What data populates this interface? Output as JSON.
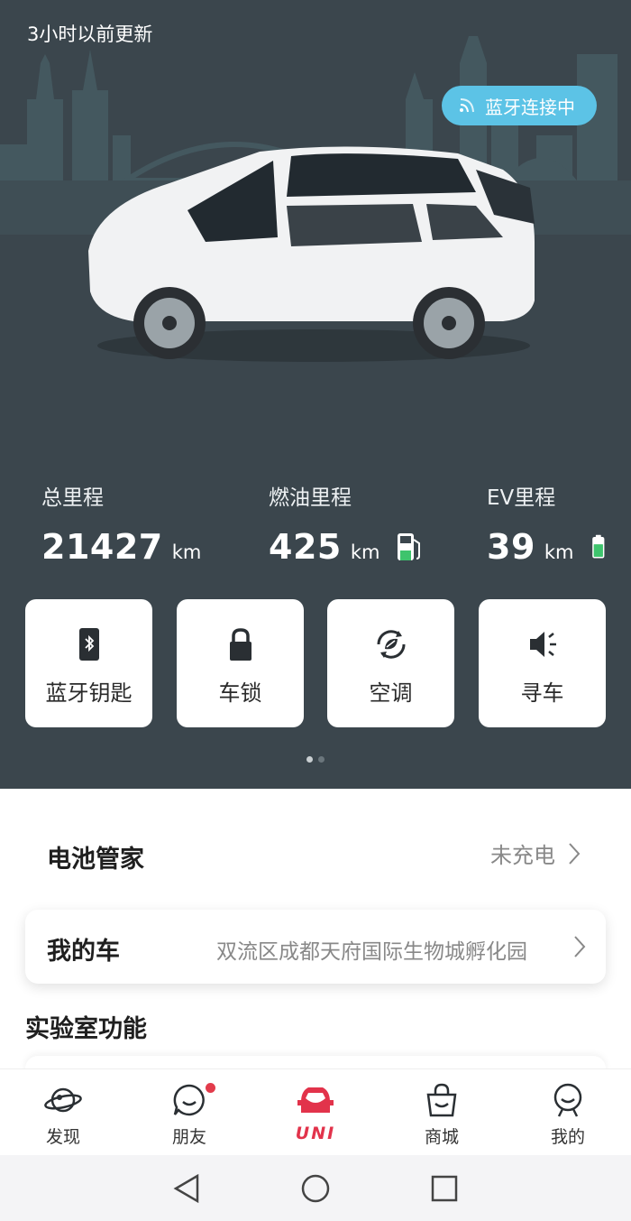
{
  "header": {
    "updated": "3小时以前更新",
    "bluetooth_status": "蓝牙连接中"
  },
  "stats": [
    {
      "label": "总里程",
      "value": "21427",
      "unit": "km"
    },
    {
      "label": "燃油里程",
      "value": "425",
      "unit": "km",
      "icon": "fuel-pump-icon"
    },
    {
      "label": "EV里程",
      "value": "39",
      "unit": "km",
      "icon": "battery-icon"
    }
  ],
  "quick_actions": [
    {
      "label": "蓝牙钥匙",
      "icon": "bluetooth-key-icon"
    },
    {
      "label": "车锁",
      "icon": "lock-icon"
    },
    {
      "label": "空调",
      "icon": "air-conditioner-icon"
    },
    {
      "label": "寻车",
      "icon": "speaker-icon"
    }
  ],
  "battery": {
    "title": "电池管家",
    "status": "未充电"
  },
  "my_car": {
    "title": "我的车",
    "address": "双流区成都天府国际生物城孵化园"
  },
  "lab": {
    "title": "实验室功能"
  },
  "tabs": [
    {
      "label": "发现",
      "icon": "planet-icon"
    },
    {
      "label": "朋友",
      "icon": "chat-icon"
    },
    {
      "label": "UNI",
      "icon": "uni-car-icon"
    },
    {
      "label": "商城",
      "icon": "shopping-bag-icon"
    },
    {
      "label": "我的",
      "icon": "profile-icon"
    }
  ],
  "colors": {
    "hero_bg": "#3b464d",
    "accent": "#e2334b",
    "bt_pill": "#5cc3e6",
    "ev_green": "#3ec46d"
  }
}
